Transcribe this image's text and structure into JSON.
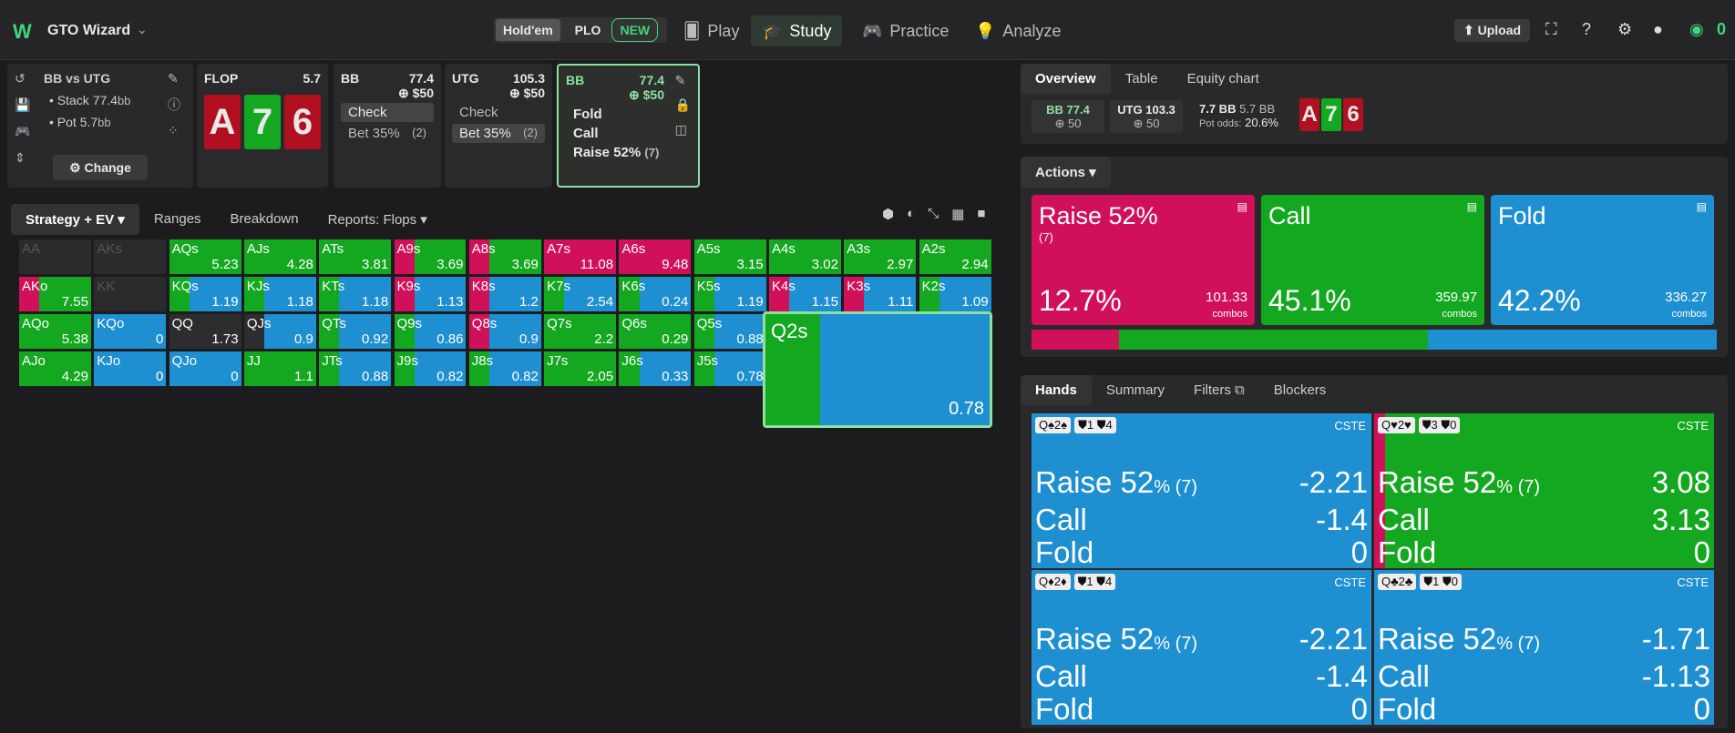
{
  "app": {
    "logo": "W",
    "brand": "GTO Wizard",
    "game_holdem": "Hold'em",
    "game_plo": "PLO",
    "new_badge": "NEW",
    "nav": [
      "Play",
      "Study",
      "Practice",
      "Analyze"
    ],
    "upload": "Upload",
    "coins": "0"
  },
  "spot": {
    "title": "BB vs UTG",
    "stack": "• Stack 77.4",
    "stack_unit": "bb",
    "pot": "• Pot 5.7",
    "pot_unit": "bb",
    "change": "Change"
  },
  "flop": {
    "label": "FLOP",
    "value": "5.7",
    "cards": [
      "A",
      "7",
      "6"
    ]
  },
  "bb1": {
    "label": "BB",
    "stack": "77.4",
    "bet": "$50",
    "actions": [
      "Check",
      "Bet 35%"
    ],
    "counts": [
      "",
      "(2)"
    ]
  },
  "utg": {
    "label": "UTG",
    "stack": "105.3",
    "bet": "$50",
    "actions": [
      "Check",
      "Bet 35%"
    ],
    "counts": [
      "",
      "(2)"
    ]
  },
  "bb2": {
    "label": "BB",
    "stack": "77.4",
    "bet": "$50",
    "actions": [
      "Fold",
      "Call",
      "Raise 52%"
    ],
    "raise_count": "(7)"
  },
  "filters": {
    "strategy": "Strategy + EV",
    "tabs": [
      "Ranges",
      "Breakdown",
      "Reports: Flops"
    ]
  },
  "grid": [
    [
      [
        "AA",
        "",
        null
      ],
      [
        "AKs",
        "",
        null
      ],
      [
        "AQs",
        "5.23",
        "g"
      ],
      [
        "AJs",
        "4.28",
        "g"
      ],
      [
        "ATs",
        "3.81",
        "g"
      ],
      [
        "A9s",
        "3.69",
        "rg"
      ],
      [
        "A8s",
        "3.69",
        "rg"
      ],
      [
        "A7s",
        "11.08",
        "r"
      ],
      [
        "A6s",
        "9.48",
        "r"
      ],
      [
        "A5s",
        "3.15",
        "g"
      ],
      [
        "A4s",
        "3.02",
        "g"
      ],
      [
        "A3s",
        "2.97",
        "g"
      ],
      [
        "A2s",
        "2.94",
        "g"
      ]
    ],
    [
      [
        "AKo",
        "7.55",
        "rg"
      ],
      [
        "KK",
        "",
        null
      ],
      [
        "KQs",
        "1.19",
        "gb"
      ],
      [
        "KJs",
        "1.18",
        "gb"
      ],
      [
        "KTs",
        "1.18",
        "gb"
      ],
      [
        "K9s",
        "1.13",
        "rb"
      ],
      [
        "K8s",
        "1.2",
        "rb"
      ],
      [
        "K7s",
        "2.54",
        "gb"
      ],
      [
        "K6s",
        "0.24",
        "gb"
      ],
      [
        "K5s",
        "1.19",
        "gb"
      ],
      [
        "K4s",
        "1.15",
        "rb"
      ],
      [
        "K3s",
        "1.11",
        "rb"
      ],
      [
        "K2s",
        "1.09",
        "gb"
      ]
    ],
    [
      [
        "AQo",
        "5.38",
        "g"
      ],
      [
        "KQo",
        "0",
        "b"
      ],
      [
        "QQ",
        "1.73",
        "k"
      ],
      [
        "QJs",
        "0.9",
        "kb"
      ],
      [
        "QTs",
        "0.92",
        "gb"
      ],
      [
        "Q9s",
        "0.86",
        "gb"
      ],
      [
        "Q8s",
        "0.9",
        "rb"
      ],
      [
        "Q7s",
        "2.2",
        "g"
      ],
      [
        "Q6s",
        "0.29",
        "g"
      ],
      [
        "Q5s",
        "0.88",
        "gb"
      ],
      [
        "",
        "",
        null
      ],
      [
        "",
        "",
        null
      ],
      [
        "",
        "",
        null
      ]
    ],
    [
      [
        "AJo",
        "4.29",
        "g"
      ],
      [
        "KJo",
        "0",
        "b"
      ],
      [
        "QJo",
        "0",
        "b"
      ],
      [
        "JJ",
        "1.1",
        "g"
      ],
      [
        "JTs",
        "0.88",
        "gb"
      ],
      [
        "J9s",
        "0.82",
        "gb"
      ],
      [
        "J8s",
        "0.82",
        "gb"
      ],
      [
        "J7s",
        "2.05",
        "g"
      ],
      [
        "J6s",
        "0.33",
        "gb"
      ],
      [
        "J5s",
        "0.78",
        "gb"
      ],
      [
        "",
        "",
        null
      ],
      [
        "",
        "",
        null
      ],
      [
        "",
        "",
        null
      ]
    ]
  ],
  "zoom": {
    "name": "Q2s",
    "ev": "0.78"
  },
  "right": {
    "tabs": [
      "Overview",
      "Table",
      "Equity chart"
    ],
    "bb_stack": "BB 77.4",
    "bb_bet": "50",
    "utg_stack": "UTG 103.3",
    "utg_bet": "50",
    "pot": "7.7 BB",
    "pot_sub": "5.7 BB",
    "pot_odds_label": "Pot odds:",
    "pot_odds": "20.6%",
    "board": [
      "A",
      "7",
      "6"
    ],
    "actions_label": "Actions"
  },
  "actions": [
    {
      "name": "Raise 52%",
      "sub": "(7)",
      "pct": "12.7%",
      "combos": "101.33",
      "combos_label": "combos",
      "color": "#d1105a"
    },
    {
      "name": "Call",
      "sub": "",
      "pct": "45.1%",
      "combos": "359.97",
      "combos_label": "combos",
      "color": "#14a820"
    },
    {
      "name": "Fold",
      "sub": "",
      "pct": "42.2%",
      "combos": "336.27",
      "combos_label": "combos",
      "color": "#1e8fd0"
    }
  ],
  "bottom_tabs": [
    "Hands",
    "Summary",
    "Filters",
    "Blockers"
  ],
  "hands": [
    {
      "combo": "Q♠2♠",
      "b1": "1",
      "b2": "4",
      "tag": "CSTE",
      "raise": "Raise 52",
      "raise_count": "% (7)",
      "raise_ev": "-2.21",
      "call": "Call",
      "call_ev": "-1.4",
      "fold": "Fold",
      "fold_ev": "0"
    },
    {
      "combo": "Q♥2♥",
      "b1": "3",
      "b2": "0",
      "tag": "CSTE",
      "raise": "Raise 52",
      "raise_count": "% (7)",
      "raise_ev": "3.08",
      "call": "Call",
      "call_ev": "3.13",
      "fold": "Fold",
      "fold_ev": "0"
    },
    {
      "combo": "Q♦2♦",
      "b1": "1",
      "b2": "4",
      "tag": "CSTE",
      "raise": "Raise 52",
      "raise_count": "% (7)",
      "raise_ev": "-2.21",
      "call": "Call",
      "call_ev": "-1.4",
      "fold": "Fold",
      "fold_ev": "0"
    },
    {
      "combo": "Q♣2♣",
      "b1": "1",
      "b2": "0",
      "tag": "CSTE",
      "raise": "Raise 52",
      "raise_count": "% (7)",
      "raise_ev": "-1.71",
      "call": "Call",
      "call_ev": "-1.13",
      "fold": "Fold",
      "fold_ev": "0"
    }
  ]
}
